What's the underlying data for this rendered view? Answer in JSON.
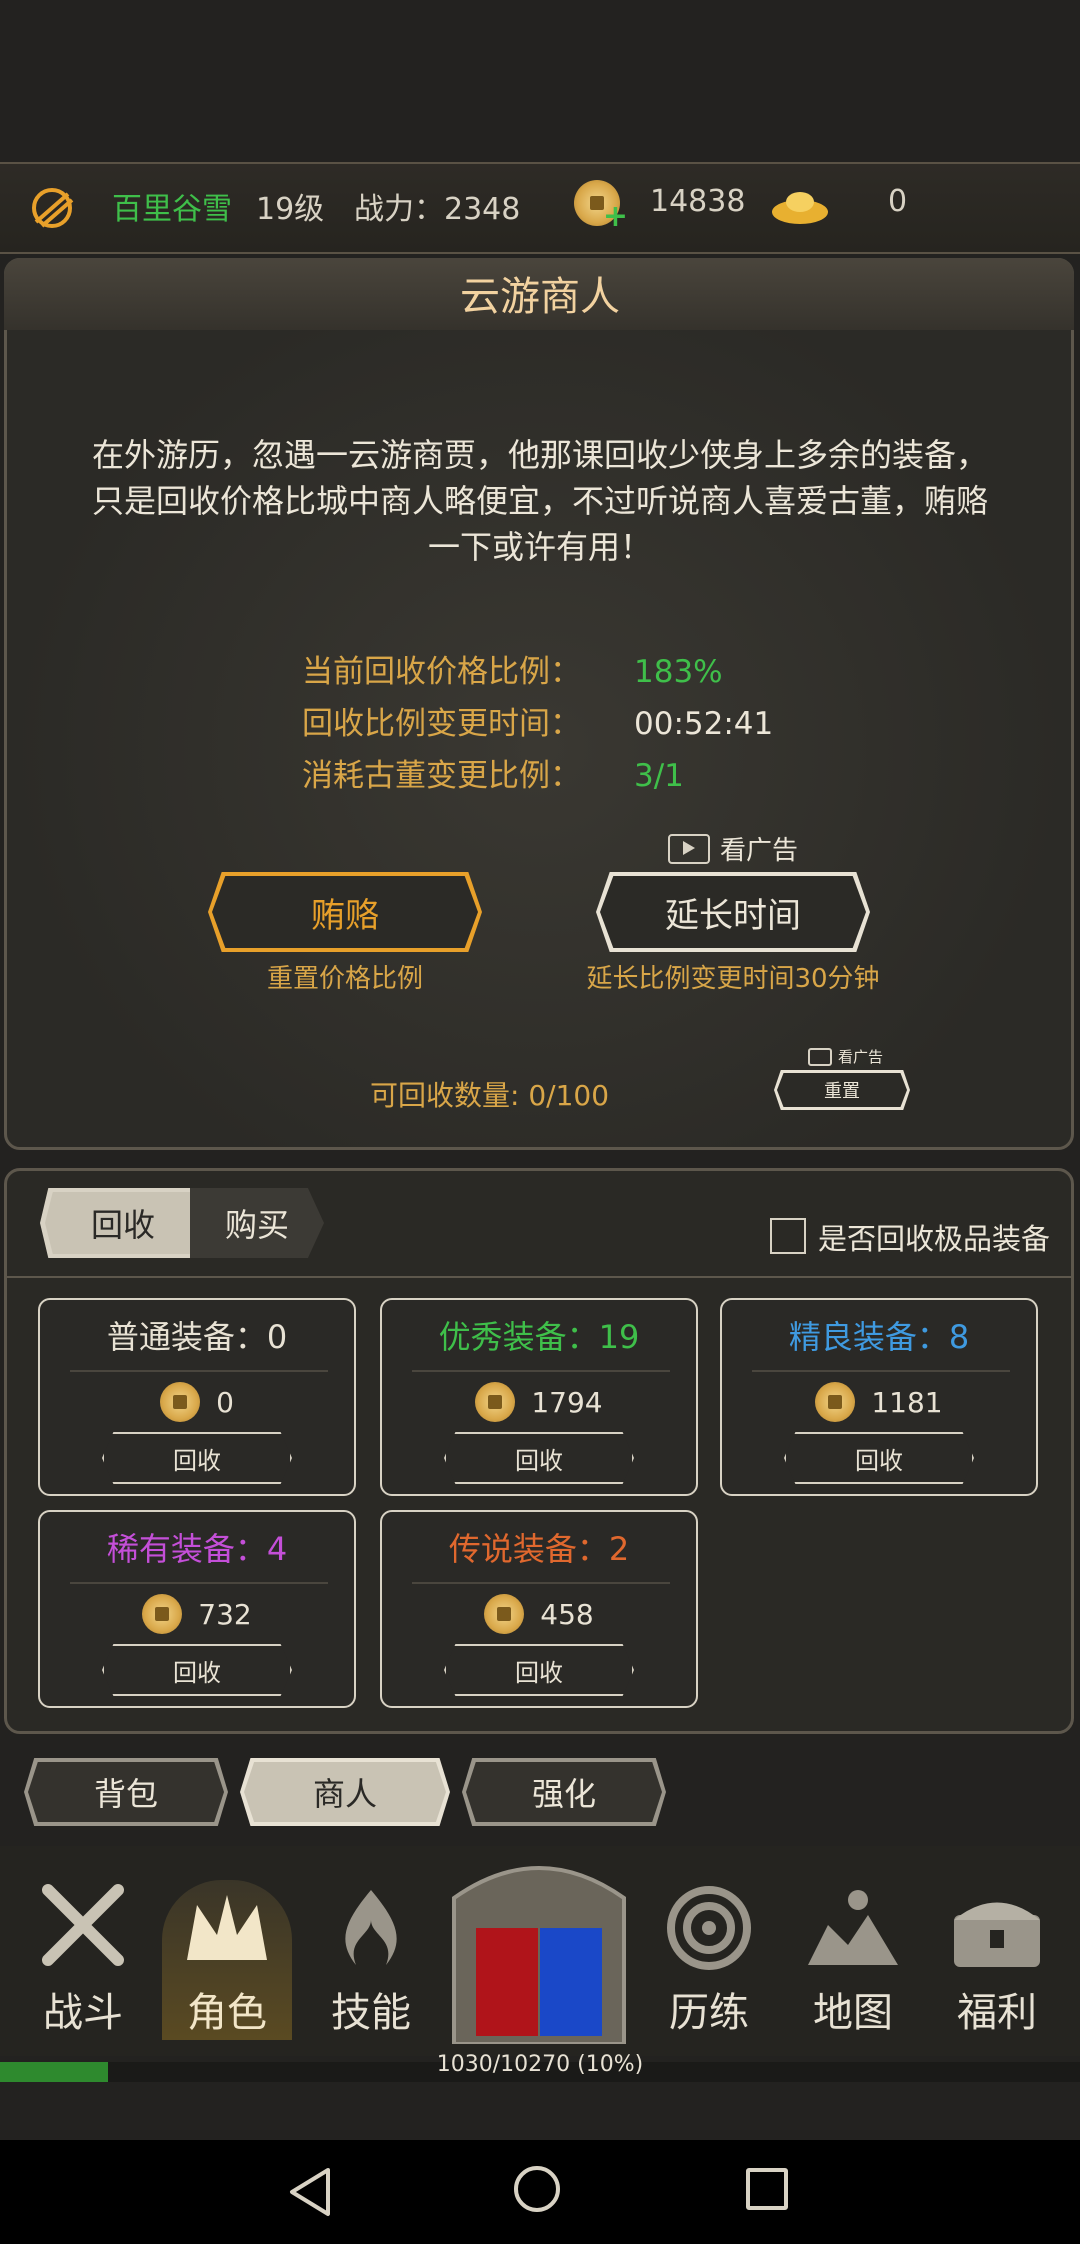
{
  "header": {
    "player_name": "百里谷雪",
    "level": "19级",
    "power_label": "战力：2348",
    "coins": "14838",
    "ingots": "0"
  },
  "panel": {
    "title": "云游商人",
    "description_line1": "在外游历，忽遇一云游商贾，他那课回收少侠身上多余的装备，",
    "description_line2": "只是回收价格比城中商人略便宜，不过听说商人喜爱古董，贿赂",
    "description_line3": "一下或许有用！",
    "stats": [
      {
        "label": "当前回收价格比例：",
        "value": "183%"
      },
      {
        "label": "回收比例变更时间：",
        "value": "00:52:41"
      },
      {
        "label": "消耗古董变更比例：",
        "value": "3/1"
      }
    ],
    "watch_ad": "看广告",
    "bribe_label": "贿赂",
    "bribe_desc": "重置价格比例",
    "extend_label": "延长时间",
    "extend_desc": "延长比例变更时间30分钟",
    "recyclable": "可回收数量: 0/100",
    "small_watch_ad": "看广告",
    "reset_label": "重置"
  },
  "tabs": {
    "recycle": "回收",
    "buy": "购买",
    "checkbox_label": "是否回收极品装备"
  },
  "cards": [
    {
      "title": "普通装备：0",
      "value": "0",
      "button": "回收",
      "color": "#e8e2d4"
    },
    {
      "title": "优秀装备：19",
      "value": "1794",
      "button": "回收",
      "color": "#3fbf4a"
    },
    {
      "title": "精良装备：8",
      "value": "1181",
      "button": "回收",
      "color": "#3f9ae0"
    },
    {
      "title": "稀有装备：4",
      "value": "732",
      "button": "回收",
      "color": "#c44fd8"
    },
    {
      "title": "传说装备：2",
      "value": "458",
      "button": "回收",
      "color": "#e0682e"
    }
  ],
  "sub_tabs": [
    "背包",
    "商人",
    "强化"
  ],
  "nav": [
    "战斗",
    "角色",
    "技能",
    "历练",
    "地图",
    "福利"
  ],
  "exp_text": "1030/10270 (10%)",
  "exp_fraction": 0.1,
  "colors": {
    "gold": "#d9a648",
    "green": "#3fbf4a",
    "accent_orange": "#e8a02a"
  }
}
